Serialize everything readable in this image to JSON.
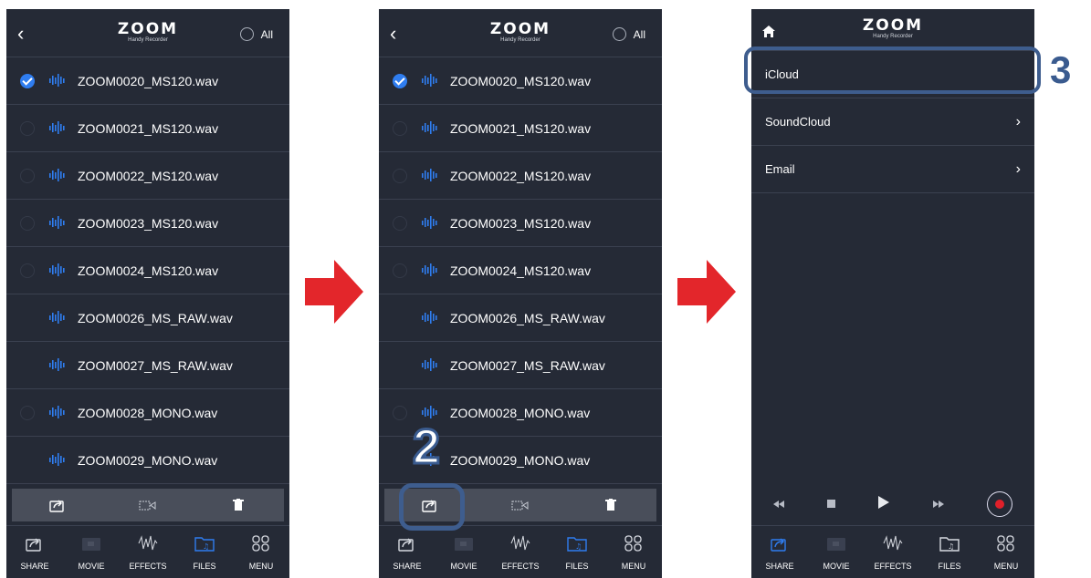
{
  "logo": {
    "brand": "ZOOM",
    "sub": "Handy Recorder"
  },
  "select_all_label": "All",
  "files": [
    {
      "name": "ZOOM0020_MS120.wav",
      "checked": true,
      "has_radio": true
    },
    {
      "name": "ZOOM0021_MS120.wav",
      "checked": false,
      "has_radio": true
    },
    {
      "name": "ZOOM0022_MS120.wav",
      "checked": false,
      "has_radio": true
    },
    {
      "name": "ZOOM0023_MS120.wav",
      "checked": false,
      "has_radio": true
    },
    {
      "name": "ZOOM0024_MS120.wav",
      "checked": false,
      "has_radio": true
    },
    {
      "name": "ZOOM0026_MS_RAW.wav",
      "checked": false,
      "has_radio": false
    },
    {
      "name": "ZOOM0027_MS_RAW.wav",
      "checked": false,
      "has_radio": false
    },
    {
      "name": "ZOOM0028_MONO.wav",
      "checked": false,
      "has_radio": true
    },
    {
      "name": "ZOOM0029_MONO.wav",
      "checked": false,
      "has_radio": false
    }
  ],
  "tabs": [
    "SHARE",
    "MOVIE",
    "EFFECTS",
    "FILES",
    "MENU"
  ],
  "share_menu": [
    {
      "label": "iCloud",
      "chevron": false
    },
    {
      "label": "SoundCloud",
      "chevron": true
    },
    {
      "label": "Email",
      "chevron": true
    }
  ],
  "callouts": {
    "step2": "2",
    "step3": "3"
  },
  "colors": {
    "bg": "#252a36",
    "accent": "#2f7df0",
    "arrow": "#e3262b",
    "callout": "#3a5b8f",
    "record": "#e0202a"
  },
  "icons": [
    "back-icon",
    "home-icon",
    "wave-icon",
    "share-icon",
    "movie-icon",
    "effects-icon",
    "files-icon",
    "menu-icon",
    "delete-icon",
    "rewind-icon",
    "stop-icon",
    "play-icon",
    "fast-forward-icon",
    "record-icon",
    "chevron-right-icon"
  ]
}
